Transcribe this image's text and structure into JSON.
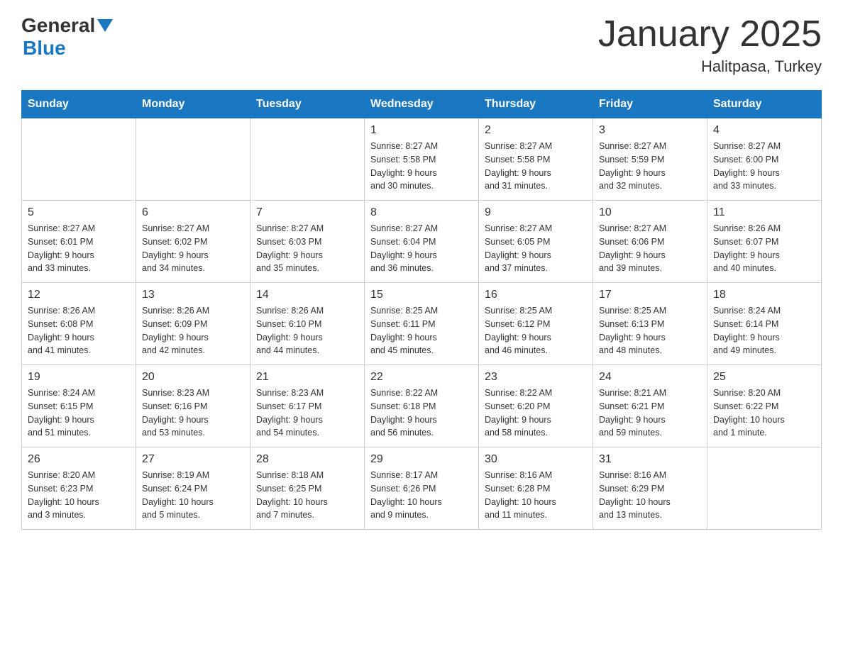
{
  "header": {
    "logo": {
      "text_general": "General",
      "text_blue": "Blue",
      "triangle": "▼"
    },
    "title": "January 2025",
    "subtitle": "Halitpasa, Turkey"
  },
  "days_of_week": [
    "Sunday",
    "Monday",
    "Tuesday",
    "Wednesday",
    "Thursday",
    "Friday",
    "Saturday"
  ],
  "weeks": [
    [
      {
        "day": "",
        "info": ""
      },
      {
        "day": "",
        "info": ""
      },
      {
        "day": "",
        "info": ""
      },
      {
        "day": "1",
        "info": "Sunrise: 8:27 AM\nSunset: 5:58 PM\nDaylight: 9 hours\nand 30 minutes."
      },
      {
        "day": "2",
        "info": "Sunrise: 8:27 AM\nSunset: 5:58 PM\nDaylight: 9 hours\nand 31 minutes."
      },
      {
        "day": "3",
        "info": "Sunrise: 8:27 AM\nSunset: 5:59 PM\nDaylight: 9 hours\nand 32 minutes."
      },
      {
        "day": "4",
        "info": "Sunrise: 8:27 AM\nSunset: 6:00 PM\nDaylight: 9 hours\nand 33 minutes."
      }
    ],
    [
      {
        "day": "5",
        "info": "Sunrise: 8:27 AM\nSunset: 6:01 PM\nDaylight: 9 hours\nand 33 minutes."
      },
      {
        "day": "6",
        "info": "Sunrise: 8:27 AM\nSunset: 6:02 PM\nDaylight: 9 hours\nand 34 minutes."
      },
      {
        "day": "7",
        "info": "Sunrise: 8:27 AM\nSunset: 6:03 PM\nDaylight: 9 hours\nand 35 minutes."
      },
      {
        "day": "8",
        "info": "Sunrise: 8:27 AM\nSunset: 6:04 PM\nDaylight: 9 hours\nand 36 minutes."
      },
      {
        "day": "9",
        "info": "Sunrise: 8:27 AM\nSunset: 6:05 PM\nDaylight: 9 hours\nand 37 minutes."
      },
      {
        "day": "10",
        "info": "Sunrise: 8:27 AM\nSunset: 6:06 PM\nDaylight: 9 hours\nand 39 minutes."
      },
      {
        "day": "11",
        "info": "Sunrise: 8:26 AM\nSunset: 6:07 PM\nDaylight: 9 hours\nand 40 minutes."
      }
    ],
    [
      {
        "day": "12",
        "info": "Sunrise: 8:26 AM\nSunset: 6:08 PM\nDaylight: 9 hours\nand 41 minutes."
      },
      {
        "day": "13",
        "info": "Sunrise: 8:26 AM\nSunset: 6:09 PM\nDaylight: 9 hours\nand 42 minutes."
      },
      {
        "day": "14",
        "info": "Sunrise: 8:26 AM\nSunset: 6:10 PM\nDaylight: 9 hours\nand 44 minutes."
      },
      {
        "day": "15",
        "info": "Sunrise: 8:25 AM\nSunset: 6:11 PM\nDaylight: 9 hours\nand 45 minutes."
      },
      {
        "day": "16",
        "info": "Sunrise: 8:25 AM\nSunset: 6:12 PM\nDaylight: 9 hours\nand 46 minutes."
      },
      {
        "day": "17",
        "info": "Sunrise: 8:25 AM\nSunset: 6:13 PM\nDaylight: 9 hours\nand 48 minutes."
      },
      {
        "day": "18",
        "info": "Sunrise: 8:24 AM\nSunset: 6:14 PM\nDaylight: 9 hours\nand 49 minutes."
      }
    ],
    [
      {
        "day": "19",
        "info": "Sunrise: 8:24 AM\nSunset: 6:15 PM\nDaylight: 9 hours\nand 51 minutes."
      },
      {
        "day": "20",
        "info": "Sunrise: 8:23 AM\nSunset: 6:16 PM\nDaylight: 9 hours\nand 53 minutes."
      },
      {
        "day": "21",
        "info": "Sunrise: 8:23 AM\nSunset: 6:17 PM\nDaylight: 9 hours\nand 54 minutes."
      },
      {
        "day": "22",
        "info": "Sunrise: 8:22 AM\nSunset: 6:18 PM\nDaylight: 9 hours\nand 56 minutes."
      },
      {
        "day": "23",
        "info": "Sunrise: 8:22 AM\nSunset: 6:20 PM\nDaylight: 9 hours\nand 58 minutes."
      },
      {
        "day": "24",
        "info": "Sunrise: 8:21 AM\nSunset: 6:21 PM\nDaylight: 9 hours\nand 59 minutes."
      },
      {
        "day": "25",
        "info": "Sunrise: 8:20 AM\nSunset: 6:22 PM\nDaylight: 10 hours\nand 1 minute."
      }
    ],
    [
      {
        "day": "26",
        "info": "Sunrise: 8:20 AM\nSunset: 6:23 PM\nDaylight: 10 hours\nand 3 minutes."
      },
      {
        "day": "27",
        "info": "Sunrise: 8:19 AM\nSunset: 6:24 PM\nDaylight: 10 hours\nand 5 minutes."
      },
      {
        "day": "28",
        "info": "Sunrise: 8:18 AM\nSunset: 6:25 PM\nDaylight: 10 hours\nand 7 minutes."
      },
      {
        "day": "29",
        "info": "Sunrise: 8:17 AM\nSunset: 6:26 PM\nDaylight: 10 hours\nand 9 minutes."
      },
      {
        "day": "30",
        "info": "Sunrise: 8:16 AM\nSunset: 6:28 PM\nDaylight: 10 hours\nand 11 minutes."
      },
      {
        "day": "31",
        "info": "Sunrise: 8:16 AM\nSunset: 6:29 PM\nDaylight: 10 hours\nand 13 minutes."
      },
      {
        "day": "",
        "info": ""
      }
    ]
  ]
}
